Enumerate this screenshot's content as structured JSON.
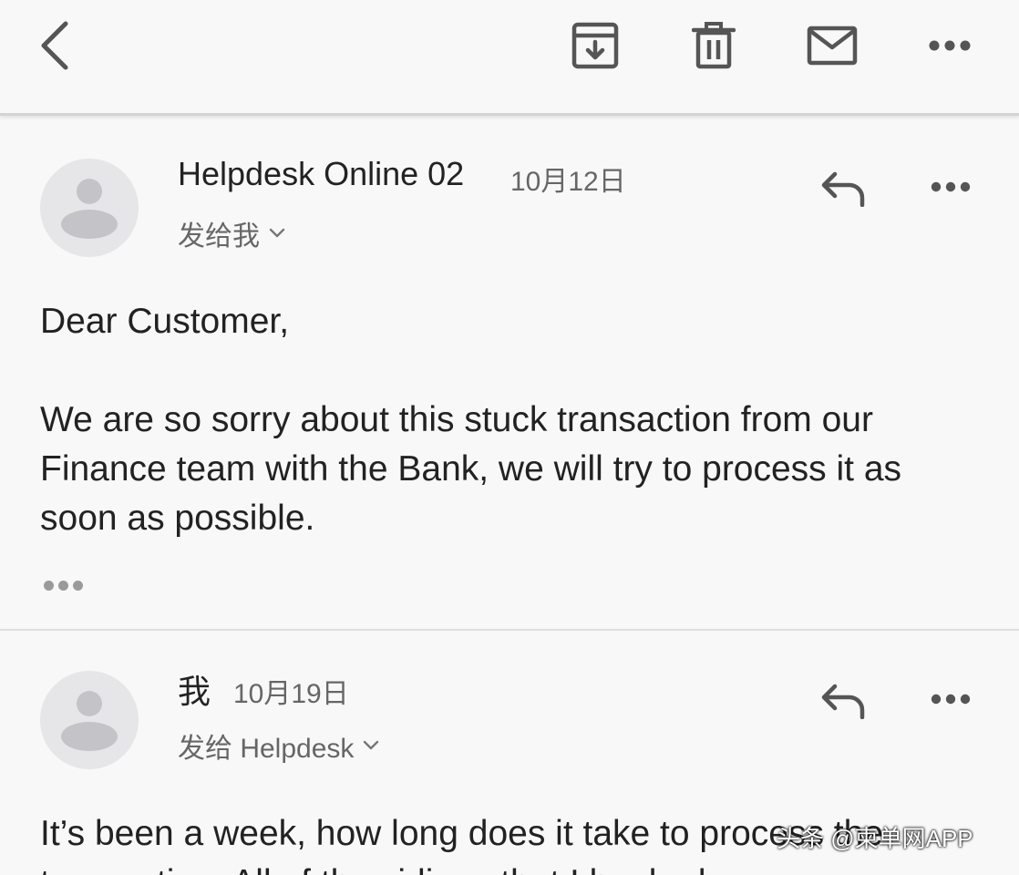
{
  "toolbar": {
    "back_icon": "chevron-left-icon",
    "archive_icon": "archive-icon",
    "delete_icon": "trash-icon",
    "mail_icon": "envelope-icon",
    "more_icon": "more-horizontal-icon"
  },
  "messages": [
    {
      "sender": "Helpdesk Online 02",
      "date": "10月12日",
      "recipient": "发给我",
      "body": [
        "Dear Customer,",
        "We are so sorry about this stuck transaction from our Finance team with the Bank, we will try to process it as soon as possible."
      ],
      "show_trimmed_content": true
    },
    {
      "sender": "我",
      "date": "10月19日",
      "recipient": "发给 Helpdesk",
      "body": [
        "It’s been a week, how long does it take to process the transaction. All of the sidings that I booked"
      ]
    }
  ],
  "watermark": "头条 @柬单网APP",
  "colors": {
    "background": "#f8f8f8",
    "icon": "#555555",
    "secondary_text": "#666666",
    "avatar_bg": "#e6e6e8"
  }
}
